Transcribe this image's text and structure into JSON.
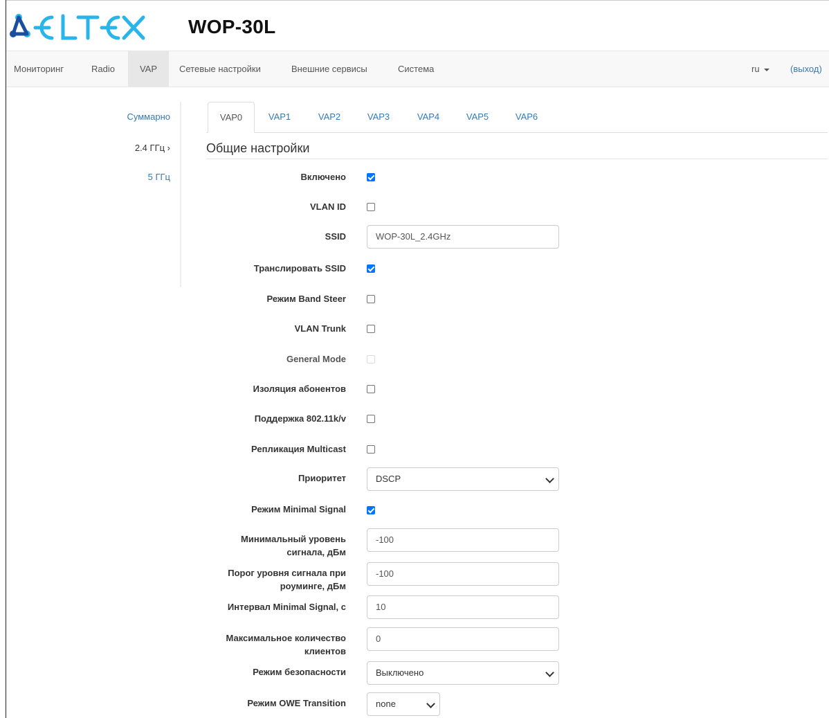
{
  "header": {
    "logo_text": "ELTEX",
    "model": "WOP-30L"
  },
  "nav": {
    "items": [
      {
        "label": "Мониторинг"
      },
      {
        "label": "Radio"
      },
      {
        "label": "VAP"
      },
      {
        "label": "Сетевые настройки"
      },
      {
        "label": "Внешние сервисы"
      },
      {
        "label": "Система"
      }
    ],
    "active": "VAP",
    "language": "ru",
    "logout": "(выход)"
  },
  "sidebar": {
    "items": [
      {
        "label": "Суммарно"
      },
      {
        "label": "2.4 ГГц ›"
      },
      {
        "label": "5 ГГц"
      }
    ]
  },
  "tabs": {
    "items": [
      {
        "label": "VAP0"
      },
      {
        "label": "VAP1"
      },
      {
        "label": "VAP2"
      },
      {
        "label": "VAP3"
      },
      {
        "label": "VAP4"
      },
      {
        "label": "VAP5"
      },
      {
        "label": "VAP6"
      }
    ],
    "active": "VAP0"
  },
  "section": {
    "title": "Общие настройки"
  },
  "form": {
    "enabled": {
      "label": "Включено",
      "checked": true
    },
    "vlan_id": {
      "label": "VLAN ID",
      "checked": false
    },
    "ssid": {
      "label": "SSID",
      "value": "WOP-30L_2.4GHz"
    },
    "broadcast_ssid": {
      "label": "Транслировать SSID",
      "checked": true
    },
    "band_steer": {
      "label": "Режим Band Steer",
      "checked": false
    },
    "vlan_trunk": {
      "label": "VLAN Trunk",
      "checked": false
    },
    "general_mode": {
      "label": "General Mode",
      "checked": false,
      "disabled": true
    },
    "client_isolation": {
      "label": "Изоляция абонентов",
      "checked": false
    },
    "support_80211kv": {
      "label": "Поддержка 802.11k/v",
      "checked": false
    },
    "multicast_replication": {
      "label": "Репликация Multicast",
      "checked": false
    },
    "priority": {
      "label": "Приоритет",
      "value": "DSCP"
    },
    "minimal_signal": {
      "label": "Режим Minimal Signal",
      "checked": true
    },
    "min_signal_level": {
      "label_line1": "Минимальный уровень",
      "label_line2": "сигнала, дБм",
      "value": "-100"
    },
    "roaming_threshold": {
      "label_line1": "Порог уровня сигнала при",
      "label_line2": "роуминге, дБм",
      "value": "-100"
    },
    "min_signal_interval": {
      "label": "Интервал Minimal Signal, с",
      "value": "10"
    },
    "max_clients": {
      "label_line1": "Максимальное количество",
      "label_line2": "клиентов",
      "value": "0"
    },
    "security_mode": {
      "label": "Режим безопасности",
      "value": "Выключено"
    },
    "owe_transition": {
      "label": "Режим OWE Transition",
      "value": "none"
    }
  },
  "colors": {
    "link": "#337ab7",
    "checkbox": "#0075ff",
    "logo_dark": "#1a4fa0",
    "logo_light": "#29b5e8"
  }
}
